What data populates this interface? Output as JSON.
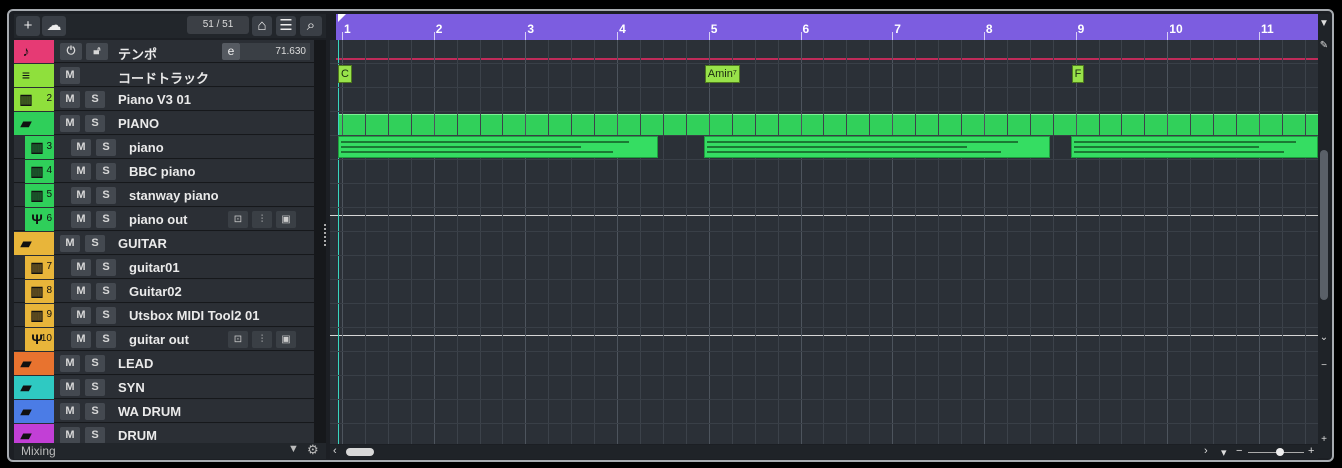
{
  "header": {
    "add_label": "+",
    "counter": "51 / 51",
    "search_icon": "search-icon"
  },
  "tracks": [
    {
      "kind": "tempo",
      "name": "テンポ",
      "color": "#e63a74",
      "glyph": "♪",
      "num": "",
      "e_label": "e",
      "tempo": "71.630"
    },
    {
      "kind": "chord",
      "name": "コードトラック",
      "color": "#8fe03c",
      "glyph": "≡",
      "num": ""
    },
    {
      "kind": "inst",
      "name": "Piano V3 01",
      "color": "#8fe03c",
      "glyph": "▥",
      "num": "2"
    },
    {
      "kind": "folder",
      "name": "PIANO",
      "color": "#2fcf5a",
      "glyph": "▰",
      "num": ""
    },
    {
      "kind": "inst",
      "name": "piano",
      "color": "#2fcf5a",
      "glyph": "▥",
      "num": "3",
      "sub": true
    },
    {
      "kind": "inst",
      "name": "BBC piano",
      "color": "#2fcf5a",
      "glyph": "▥",
      "num": "4",
      "sub": true
    },
    {
      "kind": "inst",
      "name": "stanway piano",
      "color": "#2fcf5a",
      "glyph": "▥",
      "num": "5",
      "sub": true
    },
    {
      "kind": "out",
      "name": "piano out",
      "color": "#2fcf5a",
      "glyph": "Ψ",
      "num": "6",
      "sub": true
    },
    {
      "kind": "folder",
      "name": "GUITAR",
      "color": "#e8b53a",
      "glyph": "▰",
      "num": ""
    },
    {
      "kind": "inst",
      "name": "guitar01",
      "color": "#e8b53a",
      "glyph": "▥",
      "num": "7",
      "sub": true
    },
    {
      "kind": "inst",
      "name": "Guitar02",
      "color": "#e8b53a",
      "glyph": "▥",
      "num": "8",
      "sub": true
    },
    {
      "kind": "inst",
      "name": "Utsbox MIDI Tool2 01",
      "color": "#e8b53a",
      "glyph": "▥",
      "num": "9",
      "sub": true
    },
    {
      "kind": "out",
      "name": "guitar out",
      "color": "#e8b53a",
      "glyph": "Ψ",
      "num": "10",
      "sub": true
    },
    {
      "kind": "folder",
      "name": "LEAD",
      "color": "#e8732f",
      "glyph": "▰",
      "num": ""
    },
    {
      "kind": "folder",
      "name": "SYN",
      "color": "#2fc9c2",
      "glyph": "▰",
      "num": ""
    },
    {
      "kind": "folder",
      "name": "WA DRUM",
      "color": "#4b7ce6",
      "glyph": "▰",
      "num": ""
    },
    {
      "kind": "folder",
      "name": "DRUM",
      "color": "#c23fd6",
      "glyph": "▰",
      "num": ""
    }
  ],
  "labels": {
    "mute": "M",
    "solo": "S"
  },
  "footer": {
    "label": "Mixing"
  },
  "ruler": {
    "bars": [
      "1",
      "2",
      "3",
      "4",
      "5",
      "6",
      "7",
      "8",
      "9",
      "10",
      "11"
    ]
  },
  "chords": [
    {
      "label": "C",
      "bar": 1
    },
    {
      "label": "Amin⁷",
      "bar": 5
    },
    {
      "label": "F",
      "bar": 9
    }
  ]
}
